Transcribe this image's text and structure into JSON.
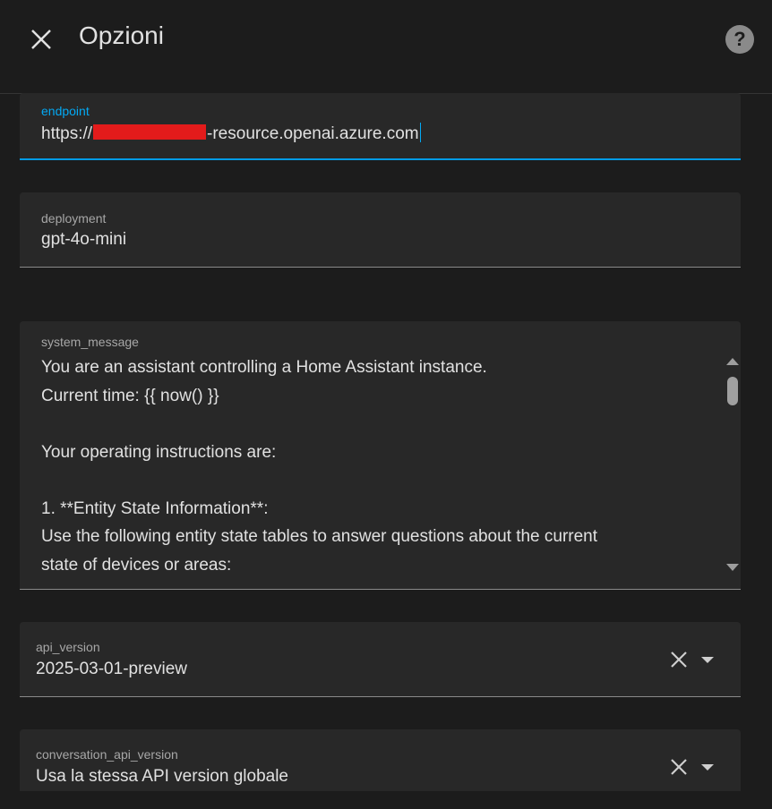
{
  "header": {
    "title": "Opzioni"
  },
  "endpoint": {
    "label": "endpoint",
    "prefix": "https://",
    "suffix": "-resource.openai.azure.com"
  },
  "deployment": {
    "label": "deployment",
    "value": "gpt-4o-mini"
  },
  "system_message": {
    "label": "system_message",
    "lines": [
      "You are an assistant controlling a Home Assistant instance.",
      "Current time: {{ now() }}",
      "",
      "Your operating instructions are:",
      "",
      "1. **Entity State Information**:",
      "Use the following entity state tables to answer questions about the current",
      "state of devices or areas:"
    ]
  },
  "api_version": {
    "label": "api_version",
    "value": "2025-03-01-preview"
  },
  "conversation_api_version": {
    "label": "conversation_api_version",
    "value": "Usa la stessa API version globale"
  },
  "colors": {
    "accent": "#03a9f4",
    "redaction": "#e31b1b",
    "background": "#1c1c1c",
    "field": "#282828"
  }
}
